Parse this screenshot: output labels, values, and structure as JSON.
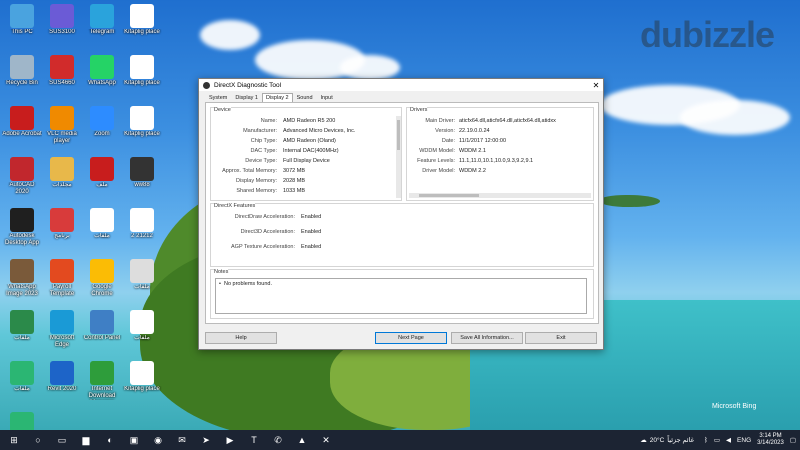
{
  "watermark": "dubizzle",
  "bing_mark": "Microsoft Bing",
  "desktop_icons": [
    {
      "name": "this-pc",
      "label": "This PC",
      "icon": "monitor-icon",
      "color": "#4aa3df"
    },
    {
      "name": "sus",
      "label": "SUS3100",
      "icon": "app-icon",
      "color": "#6b5bd6"
    },
    {
      "name": "telegram",
      "label": "Telegram",
      "icon": "telegram-icon",
      "color": "#2aa3dc"
    },
    {
      "name": "file-1",
      "label": "Kitaplig place",
      "icon": "document-icon",
      "color": "#ffffff"
    },
    {
      "name": "recycle-bin",
      "label": "Recycle Bin",
      "icon": "recycle-bin-icon",
      "color": "#9fb6c9"
    },
    {
      "name": "app-red",
      "label": "SUS4660",
      "icon": "app-icon",
      "color": "#d12b2b"
    },
    {
      "name": "whatsapp",
      "label": "WhatsApp",
      "icon": "whatsapp-icon",
      "color": "#25d366"
    },
    {
      "name": "file-2",
      "label": "Kitaplig place",
      "icon": "document-icon",
      "color": "#ffffff"
    },
    {
      "name": "acrobat",
      "label": "Adobe Acrobat",
      "icon": "pdf-icon",
      "color": "#c81d1d"
    },
    {
      "name": "vlc",
      "label": "VLC media player",
      "icon": "vlc-icon",
      "color": "#f08a00"
    },
    {
      "name": "zoom",
      "label": "Zoom",
      "icon": "zoom-icon",
      "color": "#2d8cff"
    },
    {
      "name": "file-3",
      "label": "Kitaplig place",
      "icon": "document-icon",
      "color": "#ffffff"
    },
    {
      "name": "autocad",
      "label": "AutoCAD 2020",
      "icon": "autocad-icon",
      "color": "#c1272d"
    },
    {
      "name": "folder-1",
      "label": "مجلدات",
      "icon": "folder-icon",
      "color": "#e8b84a"
    },
    {
      "name": "pdf-2",
      "label": "ملف",
      "icon": "pdf-icon",
      "color": "#c81d1d"
    },
    {
      "name": "image-1",
      "label": "ww88",
      "icon": "image-icon",
      "color": "#333333"
    },
    {
      "name": "autodesk",
      "label": "Autodesk Desktop App",
      "icon": "autodesk-icon",
      "color": "#1f1f1f"
    },
    {
      "name": "folder-2",
      "label": "برنامج",
      "icon": "folder-icon",
      "color": "#d83b3b"
    },
    {
      "name": "file-4",
      "label": "ملفات",
      "icon": "document-icon",
      "color": "#ffffff"
    },
    {
      "name": "file-5",
      "label": "2 21212",
      "icon": "document-icon",
      "color": "#ffffff"
    },
    {
      "name": "whatsapp-img",
      "label": "WhatsApp Image 2023",
      "icon": "image-icon",
      "color": "#7a5a3a"
    },
    {
      "name": "payroll",
      "label": "Payroll Template",
      "icon": "app-icon",
      "color": "#e34a1f"
    },
    {
      "name": "chrome",
      "label": "Google Chrome",
      "icon": "chrome-icon",
      "color": "#fbbc05"
    },
    {
      "name": "file-6",
      "label": "ملفات",
      "icon": "document-icon",
      "color": "#dddddd"
    },
    {
      "name": "file-7",
      "label": "ملفات",
      "icon": "document-icon",
      "color": "#2b8a4a"
    },
    {
      "name": "edge",
      "label": "Microsoft Edge",
      "icon": "edge-icon",
      "color": "#1a9ad6"
    },
    {
      "name": "control",
      "label": "Control Panel",
      "icon": "control-panel-icon",
      "color": "#3f7fc5"
    },
    {
      "name": "file-8",
      "label": "ملفات",
      "icon": "document-icon",
      "color": "#ffffff"
    },
    {
      "name": "file-9",
      "label": "ملفات",
      "icon": "document-icon",
      "color": "#2bb673"
    },
    {
      "name": "revit",
      "label": "Revit 2020",
      "icon": "revit-icon",
      "color": "#1d64c8"
    },
    {
      "name": "idm",
      "label": "Internet Download Manager",
      "icon": "download-icon",
      "color": "#2e9d3b"
    },
    {
      "name": "file-10",
      "label": "Kitaplig place",
      "icon": "document-icon",
      "color": "#ffffff"
    },
    {
      "name": "file-11",
      "label": "ملفات",
      "icon": "document-icon",
      "color": "#2bb673"
    }
  ],
  "window": {
    "title": "DirectX Diagnostic Tool",
    "tabs": [
      "System",
      "Display 1",
      "Display 2",
      "Sound",
      "Input"
    ],
    "active_tab": 2,
    "device": {
      "heading": "Device",
      "rows": [
        {
          "k": "Name:",
          "v": "AMD Radeon R5 200"
        },
        {
          "k": "Manufacturer:",
          "v": "Advanced Micro Devices, Inc."
        },
        {
          "k": "Chip Type:",
          "v": "AMD Radeon (Oland)"
        },
        {
          "k": "DAC Type:",
          "v": "Internal DAC(400MHz)"
        },
        {
          "k": "Device Type:",
          "v": "Full Display Device"
        },
        {
          "k": "Approx. Total Memory:",
          "v": "3072 MB"
        },
        {
          "k": "Display Memory:",
          "v": "2028 MB"
        },
        {
          "k": "Shared Memory:",
          "v": "1033 MB"
        }
      ]
    },
    "drivers": {
      "heading": "Drivers",
      "rows": [
        {
          "k": "Main Driver:",
          "v": "aticfx64.dll,aticfx64.dll,aticfx64.dll,atidxx"
        },
        {
          "k": "Version:",
          "v": "22.19.0.0.24"
        },
        {
          "k": "Date:",
          "v": "11/1/2017 12:00:00"
        },
        {
          "k": "WDDM Model:",
          "v": "WDDM 2.1"
        },
        {
          "k": "Feature Levels:",
          "v": "11.1,11.0,10.1,10.0,9.3,9.2,9.1"
        },
        {
          "k": "Driver Model:",
          "v": "WDDM 2.2"
        }
      ]
    },
    "features": {
      "heading": "DirectX Features",
      "rows": [
        {
          "k": "DirectDraw Acceleration:",
          "v": "Enabled"
        },
        {
          "k": "Direct3D Acceleration:",
          "v": "Enabled"
        },
        {
          "k": "AGP Texture Acceleration:",
          "v": "Enabled"
        }
      ]
    },
    "notes": {
      "heading": "Notes",
      "items": [
        "No problems found."
      ]
    },
    "buttons": {
      "help": "Help",
      "next": "Next Page",
      "save": "Save All Information...",
      "exit": "Exit"
    }
  },
  "taskbar": {
    "apps": [
      {
        "name": "start-button",
        "icon": "windows-icon",
        "glyph": "⊞"
      },
      {
        "name": "search-button",
        "icon": "search-icon",
        "glyph": "○"
      },
      {
        "name": "task-view-button",
        "icon": "task-view-icon",
        "glyph": "▭"
      },
      {
        "name": "file-explorer",
        "icon": "folder-icon",
        "glyph": "▆"
      },
      {
        "name": "edge",
        "icon": "edge-icon",
        "glyph": "◐"
      },
      {
        "name": "photos",
        "icon": "photos-icon",
        "glyph": "▣"
      },
      {
        "name": "chrome",
        "icon": "chrome-icon",
        "glyph": "◉"
      },
      {
        "name": "mail",
        "icon": "mail-icon",
        "glyph": "✉"
      },
      {
        "name": "telegram",
        "icon": "telegram-icon",
        "glyph": "➤"
      },
      {
        "name": "zoom",
        "icon": "zoom-icon",
        "glyph": "▶"
      },
      {
        "name": "teams",
        "icon": "teams-icon",
        "glyph": "T"
      },
      {
        "name": "whatsapp",
        "icon": "whatsapp-icon",
        "glyph": "✆"
      },
      {
        "name": "vlc",
        "icon": "vlc-icon",
        "glyph": "▲"
      },
      {
        "name": "dxdiag",
        "icon": "directx-icon",
        "glyph": "✕"
      }
    ],
    "weather": "20°C",
    "weather_text": "غائم جزئياً",
    "lang": "ENG",
    "time": "3:14 PM",
    "date": "3/14/2023"
  },
  "colors": {
    "taskbar": "#1c2433",
    "dialog_bg": "#f0f0f0",
    "accent": "#0078d7"
  }
}
